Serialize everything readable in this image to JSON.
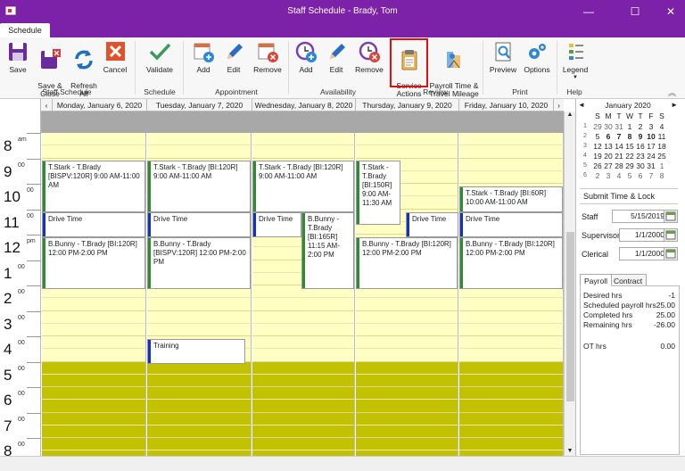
{
  "window": {
    "title": "Staff Schedule - Brady, Tom",
    "minimize": "—",
    "maximize": "☐",
    "close": "✕"
  },
  "tabs": [
    {
      "label": "Schedule"
    }
  ],
  "ribbon": {
    "buttons": {
      "save": "Save",
      "save_close": "Save &\nClose",
      "refresh_all": "Refresh\nAll",
      "cancel": "Cancel",
      "validate": "Validate",
      "appt_add": "Add",
      "appt_edit": "Edit",
      "appt_remove": "Remove",
      "avail_add": "Add",
      "avail_edit": "Edit",
      "avail_remove": "Remove",
      "service_actions": "Service\nActions",
      "payroll_mileage": "Payroll Time &\nTravel Mileage",
      "preview": "Preview",
      "options": "Options",
      "legend": "Legend"
    },
    "groups": {
      "staff": "Staff Schedule",
      "schedule": "Schedule",
      "appointment": "Appointment",
      "availability": "Availability",
      "review": "Review",
      "print": "Print",
      "help": "Help"
    },
    "accent": "#7b22a8"
  },
  "calendar": {
    "prev": "‹",
    "next": "›",
    "days": [
      "Monday, January 6, 2020",
      "Tuesday, January 7, 2020",
      "Wednesday, January 8, 2020",
      "Thursday, January 9, 2020",
      "Friday, January 10, 2020"
    ],
    "hours": [
      {
        "h": "8",
        "s": "am"
      },
      {
        "h": "9",
        "s": "00"
      },
      {
        "h": "10",
        "s": "00"
      },
      {
        "h": "11",
        "s": "00"
      },
      {
        "h": "12",
        "s": "pm"
      },
      {
        "h": "1",
        "s": "00"
      },
      {
        "h": "2",
        "s": "00"
      },
      {
        "h": "3",
        "s": "00"
      },
      {
        "h": "4",
        "s": "00"
      },
      {
        "h": "5",
        "s": "00"
      },
      {
        "h": "6",
        "s": "00"
      },
      {
        "h": "7",
        "s": "00"
      },
      {
        "h": "8",
        "s": "00"
      }
    ],
    "appointments": [
      {
        "day": 0,
        "text": "T.Stark - T.Brady [BISPV:120R] 9:00 AM-11:00 AM",
        "color": "#2e8b2e"
      },
      {
        "day": 1,
        "text": "T.Stark - T.Brady [BI:120R] 9:00 AM-11:00 AM",
        "color": "#2e8b2e"
      },
      {
        "day": 2,
        "text": "T.Stark - T.Brady [BI:120R] 9:00 AM-11:00 AM",
        "color": "#2e8b2e"
      },
      {
        "day": 3,
        "text": "T.Stark - T.Brady [BI:150R] 9:00 AM-11:30 AM",
        "color": "#2e8b2e"
      },
      {
        "day": 4,
        "text": "T.Stark - T.Brady [BI:60R] 10:00 AM-11:00 AM",
        "color": "#2e8b2e"
      },
      {
        "day": 0,
        "text": "Drive Time",
        "color": "#1030d0"
      },
      {
        "day": 1,
        "text": "Drive Time",
        "color": "#1030d0"
      },
      {
        "day": 2,
        "text": "Drive Time",
        "color": "#1030d0"
      },
      {
        "day": 3,
        "text": "Drive Time",
        "color": "#1030d0"
      },
      {
        "day": 4,
        "text": "Drive Time",
        "color": "#1030d0"
      },
      {
        "day": 2,
        "text": "B.Bunny - T.Brady [BI:165R] 11:15 AM-2:00 PM",
        "color": "#2e8b2e"
      },
      {
        "day": 0,
        "text": "B.Bunny - T.Brady [BI:120R] 12:00 PM-2:00 PM",
        "color": "#2e8b2e"
      },
      {
        "day": 1,
        "text": "B.Bunny - T.Brady [BISPV:120R] 12:00 PM-2:00 PM",
        "color": "#2e8b2e"
      },
      {
        "day": 3,
        "text": "B.Bunny - T.Brady [BI:120R] 12:00 PM-2:00 PM",
        "color": "#2e8b2e"
      },
      {
        "day": 4,
        "text": "B.Bunny - T.Brady [BI:120R] 12:00 PM-2:00 PM",
        "color": "#2e8b2e"
      },
      {
        "day": 1,
        "text": "Training",
        "color": "#1030d0"
      }
    ],
    "colors": {
      "available": "#ffffc4",
      "unavailable": "#c2c200"
    }
  },
  "minical": {
    "month": "January 2020",
    "prev": "◄",
    "next": "►",
    "dow": [
      "S",
      "M",
      "T",
      "W",
      "T",
      "F",
      "S"
    ],
    "weeks": [
      {
        "wk": "1",
        "days": [
          "29",
          "30",
          "31",
          "1",
          "2",
          "3",
          "4"
        ]
      },
      {
        "wk": "2",
        "days": [
          "5",
          "6",
          "7",
          "8",
          "9",
          "10",
          "11"
        ]
      },
      {
        "wk": "3",
        "days": [
          "12",
          "13",
          "14",
          "15",
          "16",
          "17",
          "18"
        ]
      },
      {
        "wk": "4",
        "days": [
          "19",
          "20",
          "21",
          "22",
          "23",
          "24",
          "25"
        ]
      },
      {
        "wk": "5",
        "days": [
          "26",
          "27",
          "28",
          "29",
          "30",
          "31",
          "1"
        ]
      },
      {
        "wk": "6",
        "days": [
          "2",
          "3",
          "4",
          "5",
          "6",
          "7",
          "8"
        ]
      }
    ]
  },
  "submit": {
    "title": "Submit Time & Lock",
    "staff_label": "Staff",
    "staff_value": "5/15/2019",
    "supervisor_label": "Supervisor",
    "supervisor_value": "1/1/2000",
    "clerical_label": "Clerical",
    "clerical_value": "1/1/2000"
  },
  "payroll": {
    "tabs": [
      "Payroll",
      "Contract"
    ],
    "rows": [
      {
        "label": "Desired hrs",
        "value": "-1"
      },
      {
        "label": "Scheduled payroll hrs",
        "value": "25.00"
      },
      {
        "label": "Completed hrs",
        "value": "25.00"
      },
      {
        "label": "Remaining hrs",
        "value": "-26.00"
      },
      {
        "label": "OT hrs",
        "value": "0.00"
      }
    ]
  }
}
